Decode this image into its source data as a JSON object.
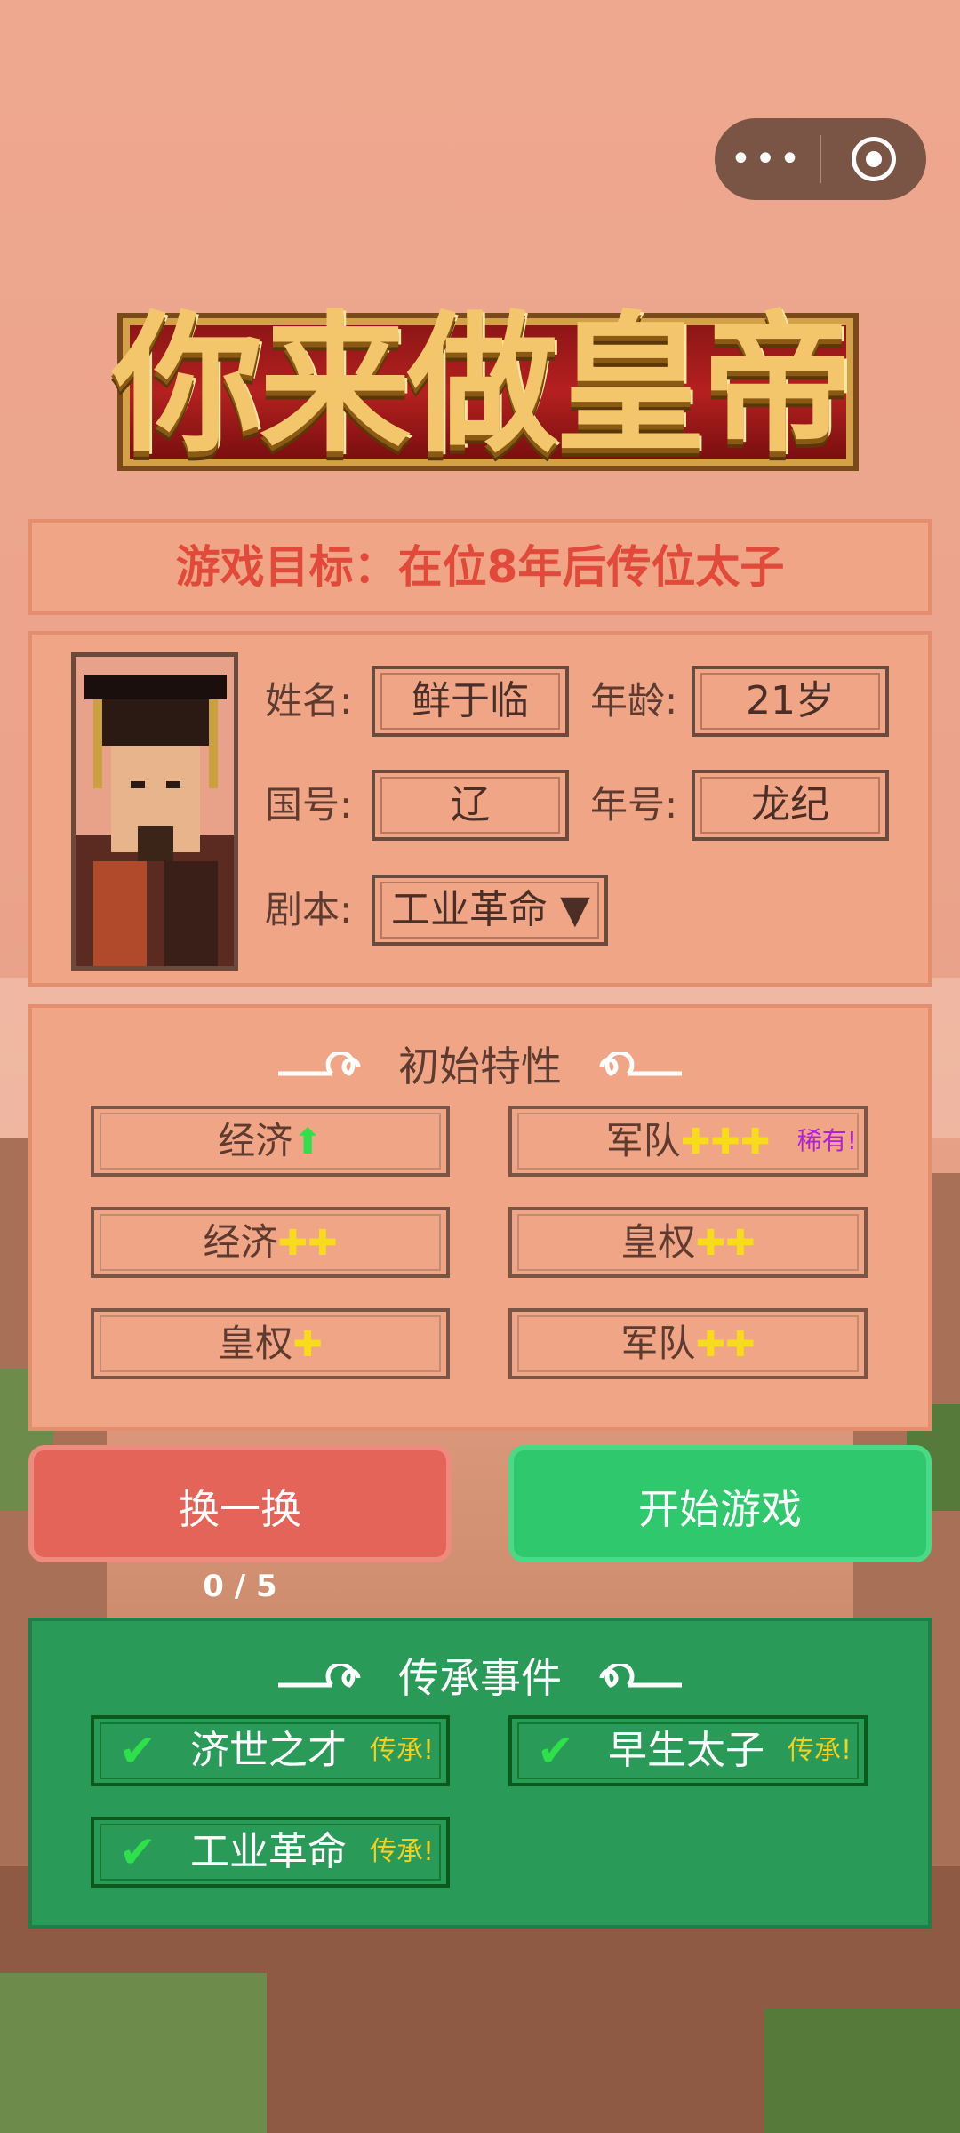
{
  "title": "你来做皇帝",
  "capsule": {
    "menu_icon": "•••",
    "record_icon": "target-icon"
  },
  "goal": {
    "text": "游戏目标：在位8年后传位太子"
  },
  "character": {
    "name_label": "姓名:",
    "name": "鲜于临",
    "age_label": "年龄:",
    "age": "21岁",
    "country_label": "国号:",
    "country": "辽",
    "era_label": "年号:",
    "era": "龙纪",
    "script_label": "剧本:",
    "script": "工业革命 ▼"
  },
  "traits": {
    "heading": "初始特性",
    "items": [
      {
        "name": "经济",
        "mark": "⬆",
        "rare": ""
      },
      {
        "name": "军队",
        "mark": "✚✚✚",
        "rare": "稀有!"
      },
      {
        "name": "经济",
        "mark": "✚✚",
        "rare": ""
      },
      {
        "name": "皇权",
        "mark": "✚✚",
        "rare": ""
      },
      {
        "name": "皇权",
        "mark": "✚",
        "rare": ""
      },
      {
        "name": "军队",
        "mark": "✚✚",
        "rare": ""
      }
    ]
  },
  "buttons": {
    "swap": "换一换",
    "start": "开始游戏",
    "counter": "0 / 5"
  },
  "legacy": {
    "heading": "传承事件",
    "items": [
      {
        "name": "济世之才",
        "tag": "传承!"
      },
      {
        "name": "早生太子",
        "tag": "传承!"
      },
      {
        "name": "工业革命",
        "tag": "传承!"
      }
    ]
  },
  "colors": {
    "goal_text": "#e14a3a",
    "start": "#30c86c",
    "swap": "#e4645a",
    "legacy_bg": "#2a9a58",
    "rare": "#b020d8",
    "plus": "#f8dc1c"
  }
}
